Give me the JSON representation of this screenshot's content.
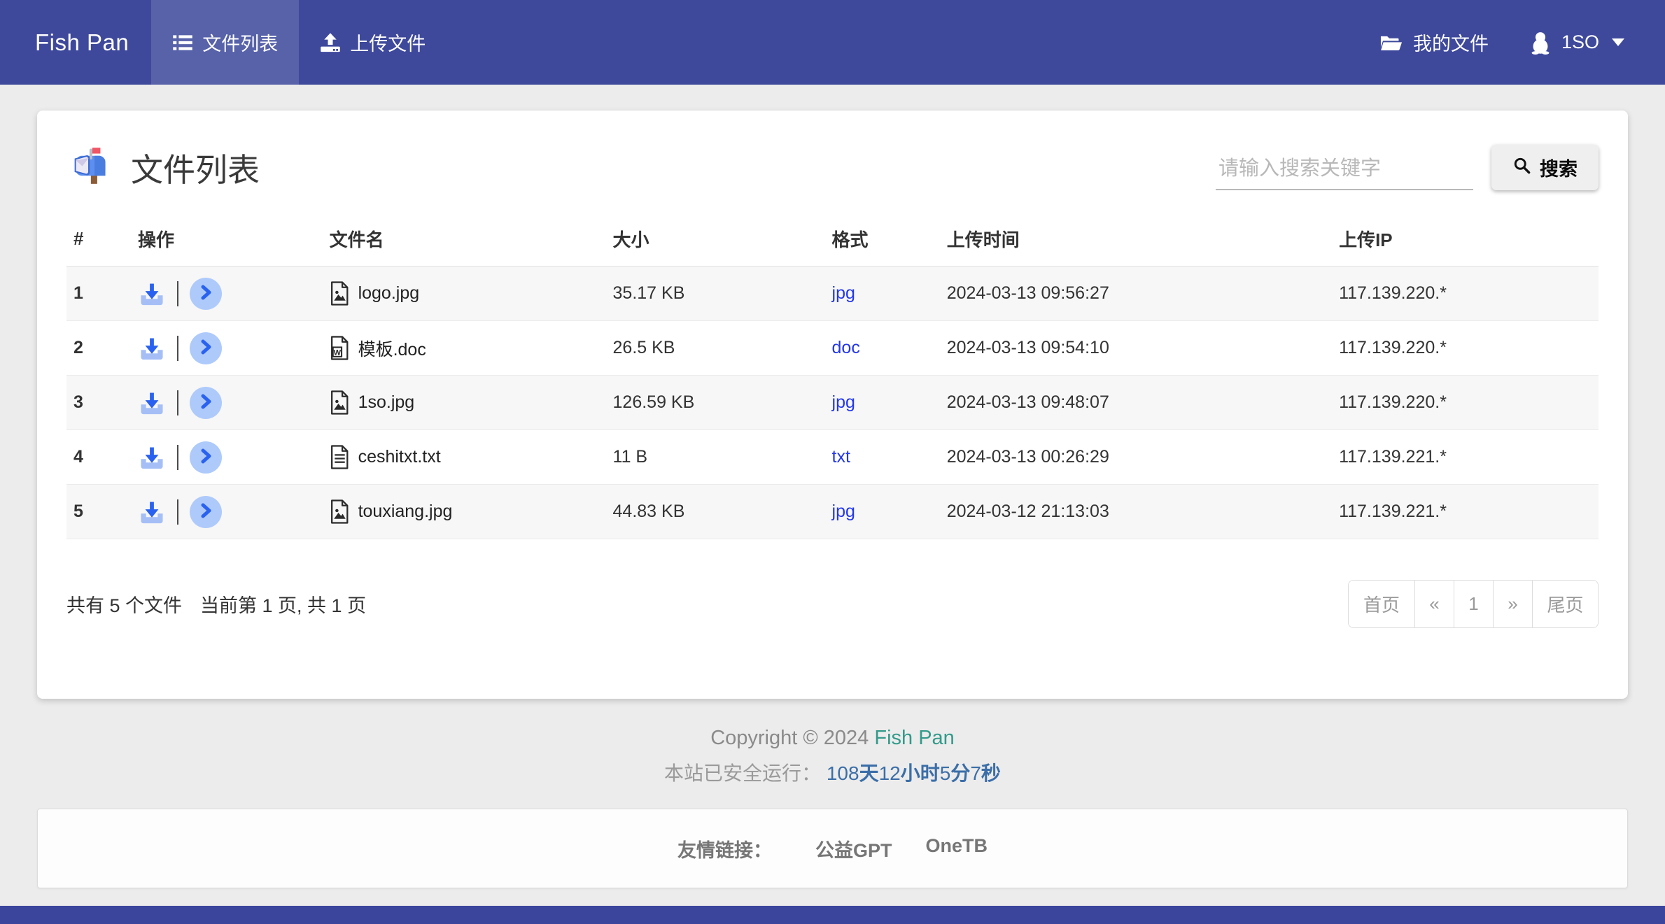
{
  "navbar": {
    "brand": "Fish Pan",
    "tabs": [
      {
        "label": "文件列表",
        "icon": "list-icon",
        "active": true
      },
      {
        "label": "上传文件",
        "icon": "upload-icon",
        "active": false
      }
    ],
    "right": {
      "my_files": "我的文件",
      "user": "1SO"
    }
  },
  "panel": {
    "title": "文件列表",
    "title_icon": "mailbox-icon",
    "search": {
      "placeholder": "请输入搜索关键字",
      "button": "搜索"
    }
  },
  "table": {
    "headers": [
      "#",
      "操作",
      "文件名",
      "大小",
      "格式",
      "上传时间",
      "上传IP"
    ],
    "rows": [
      {
        "index": "1",
        "type": "image",
        "name": "logo.jpg",
        "size": "35.17 KB",
        "format": "jpg",
        "time": "2024-03-13 09:56:27",
        "ip": "117.139.220.*"
      },
      {
        "index": "2",
        "type": "word",
        "name": "模板.doc",
        "size": "26.5 KB",
        "format": "doc",
        "time": "2024-03-13 09:54:10",
        "ip": "117.139.220.*"
      },
      {
        "index": "3",
        "type": "image",
        "name": "1so.jpg",
        "size": "126.59 KB",
        "format": "jpg",
        "time": "2024-03-13 09:48:07",
        "ip": "117.139.220.*"
      },
      {
        "index": "4",
        "type": "text",
        "name": "ceshitxt.txt",
        "size": "11 B",
        "format": "txt",
        "time": "2024-03-13 00:26:29",
        "ip": "117.139.221.*"
      },
      {
        "index": "5",
        "type": "image",
        "name": "touxiang.jpg",
        "size": "44.83 KB",
        "format": "jpg",
        "time": "2024-03-12 21:13:03",
        "ip": "117.139.221.*"
      }
    ]
  },
  "footer_bar": {
    "summary_files": "共有 5 个文件",
    "summary_pages": "当前第 1 页, 共 1 页",
    "pagination": [
      "首页",
      "«",
      "1",
      "»",
      "尾页"
    ]
  },
  "site_footer": {
    "copyright_prefix": "Copyright © 2024",
    "brand": "Fish Pan",
    "uptime_label": "本站已安全运行：",
    "uptime_parts": [
      {
        "n": "108",
        "u": "天"
      },
      {
        "n": "12",
        "u": "小时"
      },
      {
        "n": "5",
        "u": "分"
      },
      {
        "n": "7",
        "u": "秒"
      }
    ],
    "links_label": "友情链接：",
    "links": [
      "公益GPT",
      "OneTB"
    ]
  },
  "colors": {
    "navbar_bg": "#3e499b",
    "navbar_active_bg": "#5762a9",
    "format_link": "#2337ec",
    "brand_teal": "#339a8a",
    "uptime_blue": "#3b6ea8",
    "download_blue": "#2a62f0",
    "download_tray": "#a5bff6",
    "page_bg": "#ececec"
  }
}
